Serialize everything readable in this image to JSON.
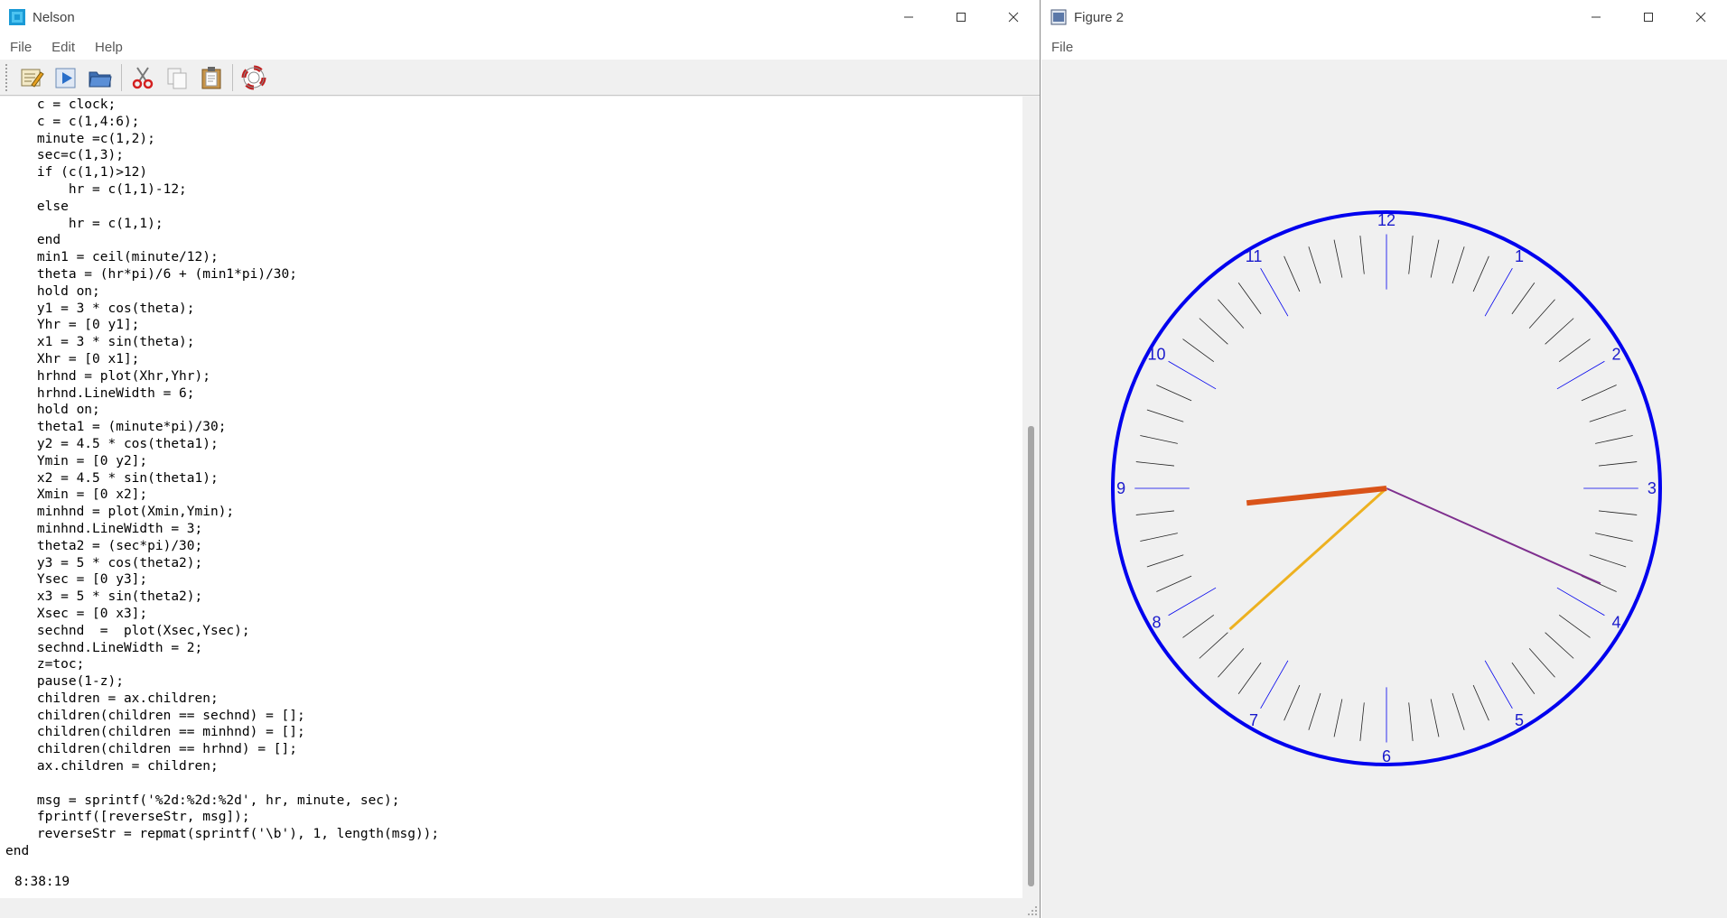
{
  "nelson_window": {
    "title": "Nelson",
    "menu": [
      "File",
      "Edit",
      "Help"
    ],
    "toolbar_icons": [
      "editor-icon",
      "run-icon",
      "open-folder-icon",
      "cut-icon",
      "copy-icon",
      "paste-icon",
      "help-icon"
    ],
    "code": "    c = clock;\n    c = c(1,4:6);\n    minute =c(1,2);\n    sec=c(1,3);\n    if (c(1,1)>12)\n        hr = c(1,1)-12;\n    else\n        hr = c(1,1);\n    end\n    min1 = ceil(minute/12);\n    theta = (hr*pi)/6 + (min1*pi)/30;\n    hold on;\n    y1 = 3 * cos(theta);\n    Yhr = [0 y1];\n    x1 = 3 * sin(theta);\n    Xhr = [0 x1];\n    hrhnd = plot(Xhr,Yhr);\n    hrhnd.LineWidth = 6;\n    hold on;\n    theta1 = (minute*pi)/30;\n    y2 = 4.5 * cos(theta1);\n    Ymin = [0 y2];\n    x2 = 4.5 * sin(theta1);\n    Xmin = [0 x2];\n    minhnd = plot(Xmin,Ymin);\n    minhnd.LineWidth = 3;\n    theta2 = (sec*pi)/30;\n    y3 = 5 * cos(theta2);\n    Ysec = [0 y3];\n    x3 = 5 * sin(theta2);\n    Xsec = [0 x3];\n    sechnd  =  plot(Xsec,Ysec);\n    sechnd.LineWidth = 2;\n    z=toc;\n    pause(1-z);\n    children = ax.children;\n    children(children == sechnd) = [];\n    children(children == minhnd) = [];\n    children(children == hrhnd) = [];\n    ax.children = children;\n\n    msg = sprintf('%2d:%2d:%2d', hr, minute, sec);\n    fprintf([reverseStr, msg]);\n    reverseStr = repmat(sprintf('\\b'), 1, length(msg));\nend",
    "output": "8:38:19"
  },
  "figure_window": {
    "title": "Figure 2",
    "menu": [
      "File"
    ],
    "clock": {
      "hour_labels": [
        "12",
        "1",
        "2",
        "3",
        "4",
        "5",
        "6",
        "7",
        "8",
        "9",
        "10",
        "11"
      ],
      "time": {
        "hour": 8,
        "minute": 38,
        "second": 19
      },
      "rim_color": "#0000ee",
      "label_color": "#1a1acc",
      "hour_hand_color": "#d95319",
      "minute_hand_color": "#edb120",
      "second_hand_color": "#7e2f8e"
    }
  }
}
